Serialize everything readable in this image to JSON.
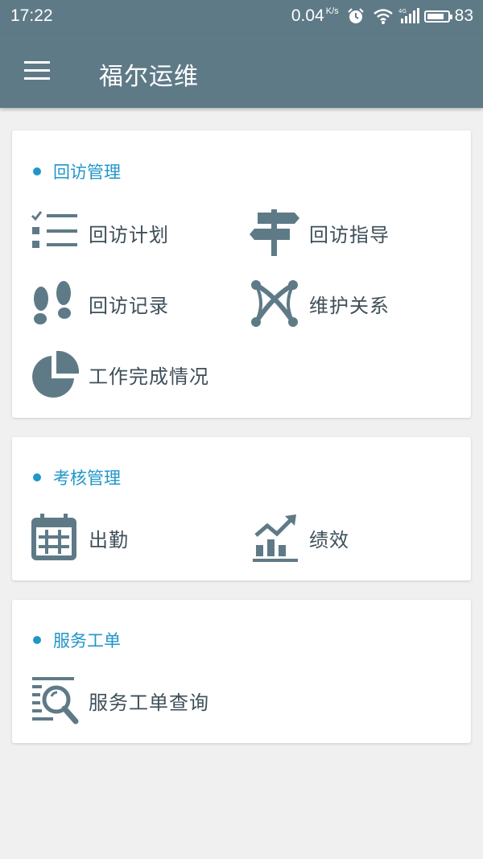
{
  "status_bar": {
    "time": "17:22",
    "net_speed": "0.04",
    "net_unit": "K/s",
    "battery_level": "83",
    "icons": [
      "alarm-icon",
      "wifi-icon",
      "signal-4g-icon",
      "battery-icon"
    ]
  },
  "app_bar": {
    "title": "福尔运维",
    "menu_icon": "hamburger-menu-icon"
  },
  "sections": [
    {
      "title": "回访管理",
      "items": [
        {
          "label": "回访计划",
          "icon": "checklist-icon"
        },
        {
          "label": "回访指导",
          "icon": "signpost-icon"
        },
        {
          "label": "回访记录",
          "icon": "footprints-icon"
        },
        {
          "label": "维护关系",
          "icon": "network-icon"
        },
        {
          "label": "工作完成情况",
          "icon": "pie-chart-icon"
        }
      ]
    },
    {
      "title": "考核管理",
      "items": [
        {
          "label": "出勤",
          "icon": "calendar-icon"
        },
        {
          "label": "绩效",
          "icon": "growth-chart-icon"
        }
      ]
    },
    {
      "title": "服务工单",
      "items": [
        {
          "label": "服务工单查询",
          "icon": "document-search-icon"
        }
      ]
    }
  ],
  "colors": {
    "primary": "#5f7a87",
    "accent": "#2196c9",
    "icon": "#5f7a87",
    "text": "#3e4f58",
    "background": "#f0f0f0",
    "card": "#ffffff"
  }
}
